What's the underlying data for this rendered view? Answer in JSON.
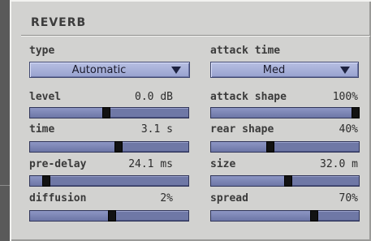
{
  "panel": {
    "title": "REVERB"
  },
  "left": {
    "type": {
      "label": "type",
      "value": "Automatic"
    },
    "sliders": [
      {
        "id": "level",
        "label": "level",
        "value": "0.0 dB",
        "position": 0.48
      },
      {
        "id": "time",
        "label": "time",
        "value": "3.1 s",
        "position": 0.56
      },
      {
        "id": "pre-delay",
        "label": "pre-delay",
        "value": "24.1 ms",
        "position": 0.1
      },
      {
        "id": "diffusion",
        "label": "diffusion",
        "value": "2%",
        "position": 0.52
      }
    ]
  },
  "right": {
    "attack_time": {
      "label": "attack time",
      "value": "Med"
    },
    "sliders": [
      {
        "id": "attack-shape",
        "label": "attack shape",
        "value": "100%",
        "position": 0.98
      },
      {
        "id": "rear-shape",
        "label": "rear shape",
        "value": "40%",
        "position": 0.4
      },
      {
        "id": "size",
        "label": "size",
        "value": "32.0 m",
        "position": 0.52
      },
      {
        "id": "spread",
        "label": "spread",
        "value": "70%",
        "position": 0.7
      }
    ]
  },
  "colors": {
    "panel_bg": "#d2d2d0",
    "control_blue": "#98a2cf",
    "slider_track": "#6f78a6",
    "thumb": "#121212"
  },
  "icons": {
    "dropdown_arrow": "triangle-down-icon"
  }
}
